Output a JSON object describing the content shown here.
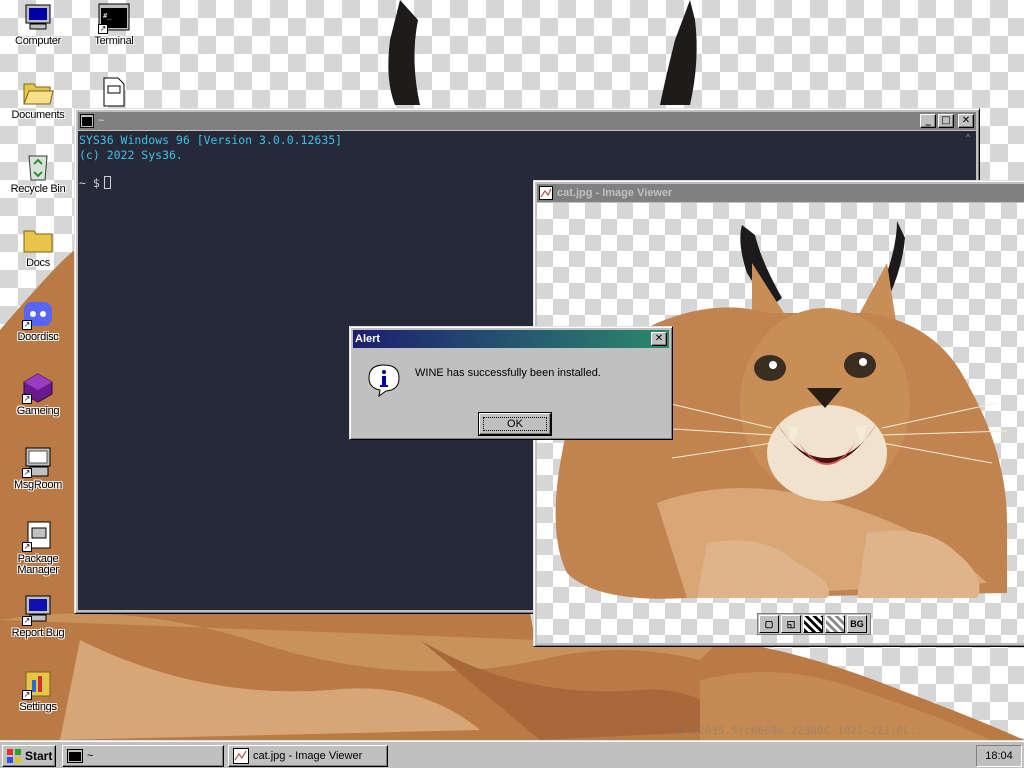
{
  "desktop": {
    "icons": [
      {
        "label": "Computer",
        "icon": "computer-icon"
      },
      {
        "label": "Terminal",
        "icon": "terminal-icon"
      },
      {
        "label": "Documents",
        "icon": "folder-open-icon"
      },
      {
        "label": "Recycle Bin",
        "icon": "recycle-bin-icon"
      },
      {
        "label": "Docs",
        "icon": "folder-icon"
      },
      {
        "label": "Doordisc",
        "icon": "doordisc-icon"
      },
      {
        "label": "Gameing",
        "icon": "gameing-icon"
      },
      {
        "label": "MsgRoom",
        "icon": "msgroom-icon"
      },
      {
        "label": "Package Manager",
        "icon": "package-manager-icon"
      },
      {
        "label": "Report Bug",
        "icon": "report-bug-icon"
      },
      {
        "label": "Settings",
        "icon": "settings-icon"
      }
    ]
  },
  "terminal": {
    "title": "~",
    "line1": "SYS36 Windows 96 [Version 3.0.0.12635]",
    "line2": "(c) 2022 Sys36.",
    "prompt": "~ $",
    "colors": {
      "background": "#262937",
      "text": "#3fc1e8"
    }
  },
  "image_viewer": {
    "title": "cat.jpg - Image Viewer",
    "toolbar": [
      {
        "icon": "fit-icon"
      },
      {
        "icon": "actual-size-icon"
      },
      {
        "icon": "checker-bg-icon"
      },
      {
        "icon": "checker-bg-alt-icon"
      },
      {
        "label": "BG"
      }
    ]
  },
  "alert": {
    "title": "Alert",
    "message": "WINE has successfully been installed.",
    "ok_label": "OK",
    "icon": "info-icon",
    "title_gradient": [
      "#1d1f71",
      "#2b8a6c"
    ]
  },
  "taskbar": {
    "start_label": "Start",
    "tasks": [
      {
        "label": "~",
        "icon": "terminal-icon",
        "active": false
      },
      {
        "label": "cat.jpg - Image Viewer",
        "icon": "image-viewer-icon",
        "active": false
      }
    ],
    "clock": "18:04"
  },
  "watermark": {
    "build": "d 12635.5fc6668e.2238DC-1021-22J.PL..."
  }
}
